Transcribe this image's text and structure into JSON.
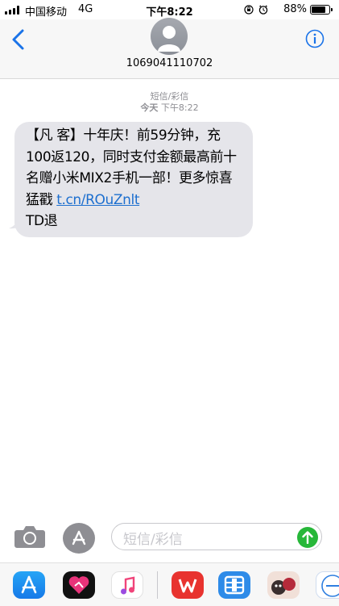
{
  "status_bar": {
    "carrier": "中国移动",
    "network": "4G",
    "time": "下午8:22",
    "battery": "88%",
    "battery_level": 0.88
  },
  "header": {
    "contact": "1069041110702"
  },
  "thread": {
    "service_label": "短信/彩信",
    "timestamp_day": "今天",
    "timestamp_time": "下午8:22",
    "message_text": "【凡 客】十年庆！前59分钟，充100返120，同时支付金额最高前十名赠小米MIX2手机一部！更多惊喜猛戳",
    "message_link": "t.cn/ROuZnlt",
    "message_suffix": "TD退"
  },
  "compose": {
    "placeholder": "短信/彩信"
  },
  "app_tray": {
    "apps": [
      "app-store-icon",
      "heart-app-icon",
      "music-icon",
      "wps-icon",
      "video-app-icon",
      "sticker-app-icon",
      "ifly-icon"
    ]
  },
  "colors": {
    "accent": "#1a73e8",
    "bubble": "#e5e5ea",
    "send": "#27b739"
  }
}
